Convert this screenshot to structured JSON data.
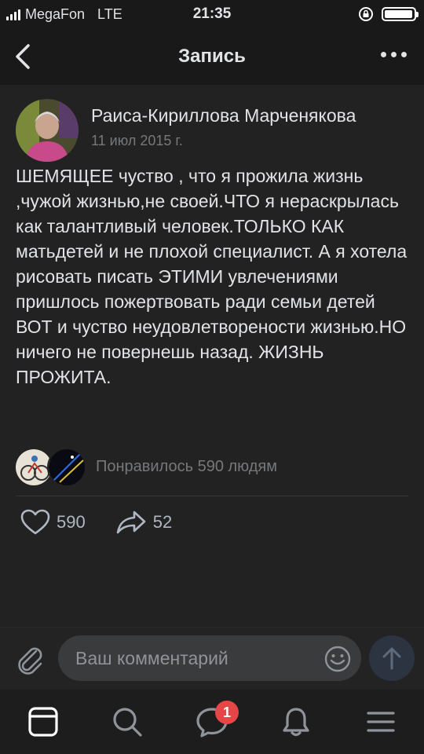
{
  "status_bar": {
    "carrier": "MegaFon",
    "network": "LTE",
    "time": "21:35"
  },
  "nav": {
    "title": "Запись"
  },
  "post": {
    "author_name": "Раиса-Кириллова Марченякова",
    "date": "11 июл 2015 г.",
    "text": "ШЕМЯЩЕЕ чуство , что я прожила жизнь ,чужой жизнью,не своей.ЧТО я нераскрылась  как талантливый человек.ТОЛЬКО КАК матьдетей  и не плохой специалист. А я хотела рисовать писать ЭТИМИ  увлечениями пришлось пожертвовать ради  семьи детей ВОТ и чуство  неудовлетворености жизнью.НО ничего не повернешь назад. ЖИЗНЬ ПРОЖИТА.",
    "likes_text": "Понравилось 590 людям",
    "like_count": "590",
    "share_count": "52"
  },
  "composer": {
    "placeholder": "Ваш комментарий"
  },
  "tabbar": {
    "messages_badge": "1"
  },
  "colors": {
    "background": "#19191a",
    "card": "#222223",
    "text": "#e1e3e6",
    "secondary": "#76787a",
    "badge": "#e64646"
  }
}
